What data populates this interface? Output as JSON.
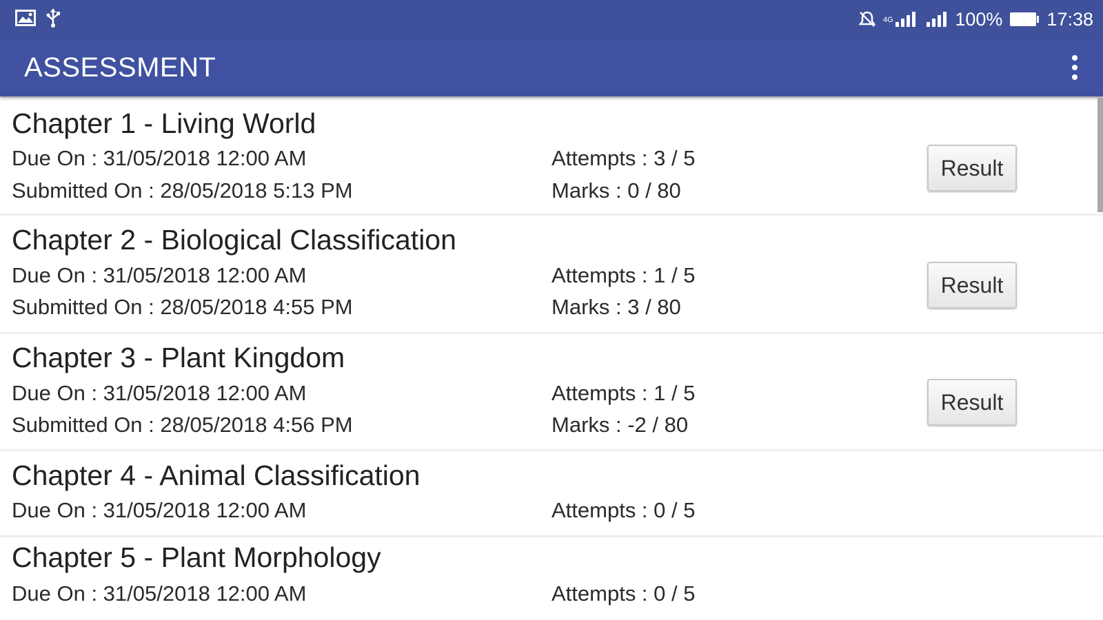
{
  "status_bar": {
    "left_icons": [
      "image-icon",
      "usb-icon"
    ],
    "right_icons": [
      "mute-icon",
      "4g-signal-icon",
      "signal-icon"
    ],
    "battery": "100%",
    "time": "17:38"
  },
  "app_bar": {
    "title": "ASSESSMENT",
    "menu_icon": "overflow-menu-icon"
  },
  "assessments": [
    {
      "title": "Chapter 1 - Living World",
      "due": "Due On : 31/05/2018 12:00 AM",
      "submitted": "Submitted On : 28/05/2018 5:13 PM",
      "attempts": "Attempts : 3 / 5",
      "marks": "Marks : 0 / 80",
      "button": "Result"
    },
    {
      "title": "Chapter 2 - Biological Classification",
      "due": "Due On : 31/05/2018 12:00 AM",
      "submitted": "Submitted On : 28/05/2018 4:55 PM",
      "attempts": "Attempts : 1 / 5",
      "marks": "Marks : 3 / 80",
      "button": "Result"
    },
    {
      "title": "Chapter 3 - Plant Kingdom",
      "due": "Due On : 31/05/2018 12:00 AM",
      "submitted": "Submitted On : 28/05/2018 4:56 PM",
      "attempts": "Attempts : 1 / 5",
      "marks": "Marks : -2 / 80",
      "button": "Result"
    },
    {
      "title": "Chapter 4 - Animal Classification",
      "due": "Due On : 31/05/2018 12:00 AM",
      "attempts": "Attempts : 0 / 5"
    },
    {
      "title": "Chapter 5 - Plant Morphology",
      "due": "Due On : 31/05/2018 12:00 AM",
      "attempts": "Attempts : 0 / 5"
    }
  ],
  "colors": {
    "status_bar": "#3e519a",
    "app_bar": "#3f51a0",
    "divider": "#eeeeee"
  }
}
